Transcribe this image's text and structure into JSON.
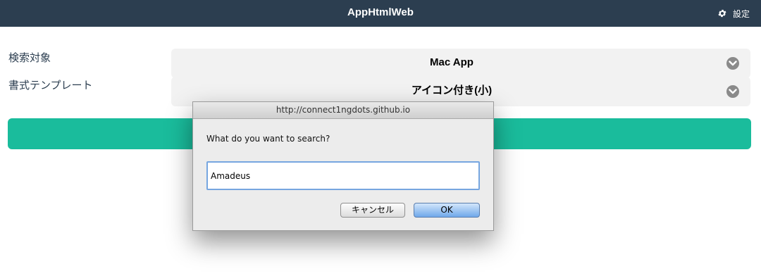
{
  "navbar": {
    "title": "AppHtmlWeb",
    "settings_label": "設定",
    "settings_icon": "gear-icon",
    "color": "#2c3e50"
  },
  "form": {
    "search_target_label": "検索対象",
    "search_target_value": "Mac App",
    "template_label": "書式テンプレート",
    "template_value": "アイコン付き(小)",
    "dropdown_icon": "chevron-down-icon",
    "accent_color": "#1abc9c"
  },
  "dialog": {
    "origin": "http://connect1ngdots.github.io",
    "message": "What do you want to search?",
    "input_value": "Amadeus",
    "cancel_label": "キャンセル",
    "ok_label": "OK"
  }
}
